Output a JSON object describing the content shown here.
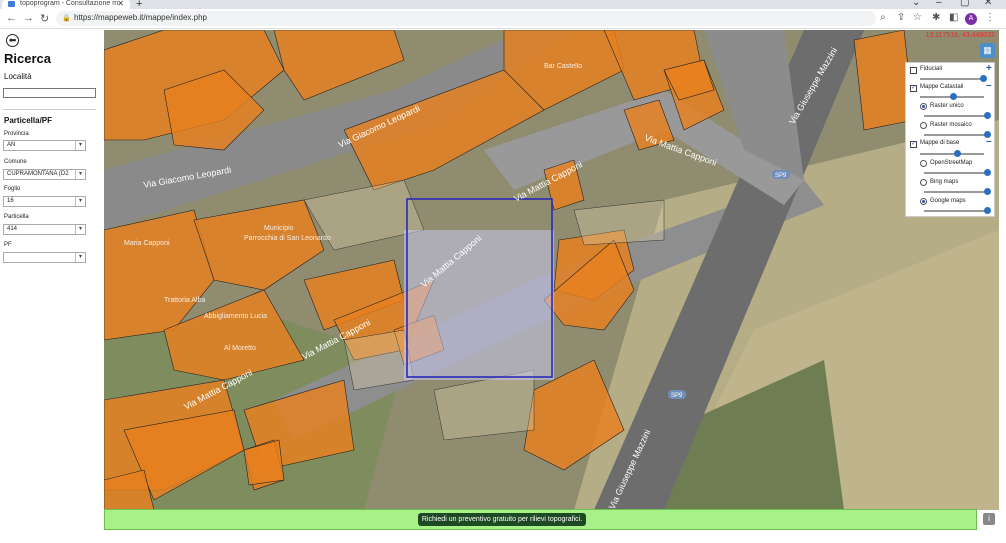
{
  "browser": {
    "tab_title": "topoprogram - Consultazione m",
    "tab_close": "✕",
    "new_tab": "+",
    "url": "https://mappeweb.it/mappe/index.php",
    "profile_initial": "A"
  },
  "sidebar": {
    "back_icon": "⬅",
    "title": "Ricerca",
    "locality_label": "Località",
    "locality_value": "",
    "section_title": "Particella/PF",
    "fields": [
      {
        "label": "Provincia",
        "value": "AN"
      },
      {
        "label": "Comune",
        "value": "CUPRAMONTANA (D2"
      },
      {
        "label": "Foglio",
        "value": "16"
      },
      {
        "label": "Particella",
        "value": "414"
      },
      {
        "label": "PF",
        "value": ""
      }
    ]
  },
  "map": {
    "coordinates": "13.117516, 43.449032",
    "street_labels": [
      "Via Giacomo Leopardi",
      "Via Giacomo Leopardi",
      "Via Mattia Capponi",
      "Via Mattia Capponi",
      "Via Mattia Capponi",
      "Via Mattia Capponi",
      "Via Mattia Capponi",
      "Via Giuseppe Mazzini",
      "Via Giuseppe Mazzini"
    ],
    "road_badges": [
      "SP9",
      "SP9"
    ],
    "poi_labels": [
      "Bar Castello",
      "Municipio",
      "Parrocchia di San Leonardo",
      "Trattoria Alba",
      "Abbigliamento Lucia",
      "Al Moretto",
      "Maria Capponi"
    ]
  },
  "layers": {
    "fiduciali": "Fiduciali",
    "mappe_catastali": "Mappe Catastali",
    "raster_unico": "Raster unico",
    "raster_mosaico": "Raster mosaico",
    "mappe_base": "Mappe di base",
    "osm": "OpenStreetMap",
    "bing": "Bing maps",
    "google": "Google maps"
  },
  "footer": {
    "promo": "Richiedi un preventivo gratuito per rilievi topografici.",
    "info": "i"
  },
  "colors": {
    "parcel": "#e8801e",
    "selection": "#2a2ab8",
    "accent": "#2b6fc0"
  }
}
